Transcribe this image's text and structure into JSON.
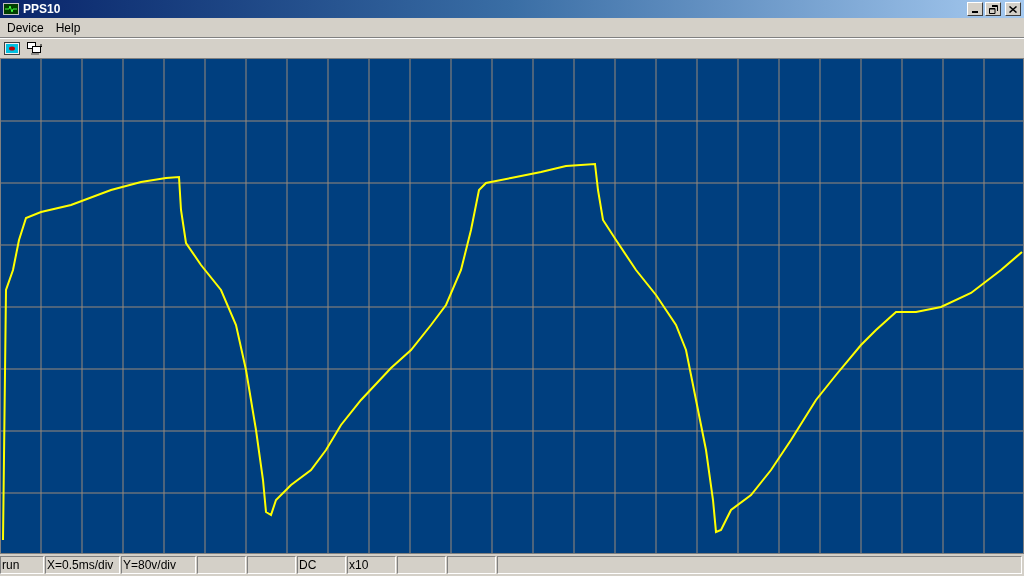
{
  "window": {
    "title": "PPS10"
  },
  "menu": [
    "Device",
    "Help"
  ],
  "status_bar": [
    {
      "kind": "text",
      "text": "run"
    },
    {
      "kind": "text",
      "text": "X=0.5ms/div"
    },
    {
      "kind": "text",
      "text": "Y=80v/div"
    },
    {
      "kind": "blank"
    },
    {
      "kind": "blank"
    },
    {
      "kind": "text",
      "text": "DC"
    },
    {
      "kind": "text",
      "text": "x10"
    },
    {
      "kind": "blank"
    },
    {
      "kind": "blank"
    },
    {
      "kind": "wide"
    }
  ]
}
